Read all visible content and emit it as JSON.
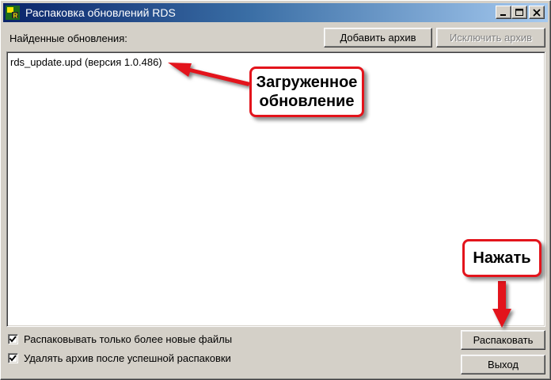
{
  "window": {
    "title": "Распаковка обновлений RDS",
    "controls": [
      "minimize-icon",
      "maximize-icon",
      "close-icon"
    ]
  },
  "updates": {
    "label": "Найденные обновления:",
    "add_button": "Добавить архив",
    "remove_button": "Исключить архив",
    "remove_enabled": false,
    "items": [
      "rds_update.upd (версия 1.0.486)"
    ]
  },
  "options": {
    "only_newer": {
      "label": "Распаковывать только более новые файлы",
      "checked": true
    },
    "delete_after": {
      "label": "Удалять архив после успешной распаковки",
      "checked": true
    }
  },
  "actions": {
    "unpack_button": "Распаковать",
    "exit_button": "Выход"
  },
  "annotations": {
    "loaded_update": "Загруженное обновление",
    "press": "Нажать",
    "color": "#e3141c"
  }
}
